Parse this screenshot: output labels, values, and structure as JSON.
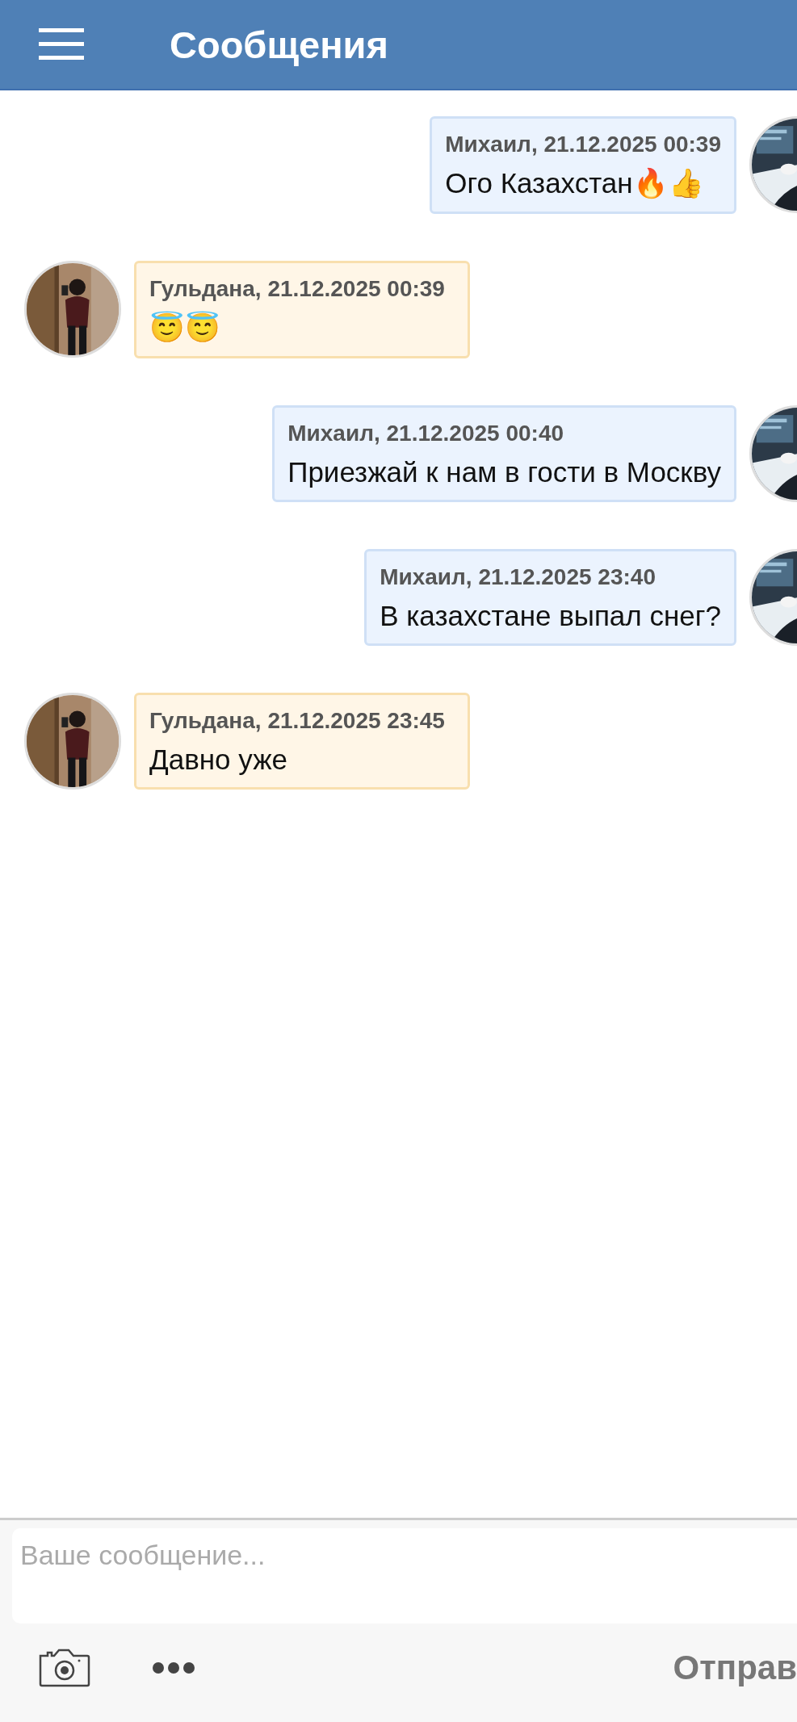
{
  "header": {
    "title": "Сообщения"
  },
  "messages": [
    {
      "kind": "outgoing",
      "meta": "Михаил, 21.12.2025 00:39",
      "text": "Ого Казахстан🔥👍"
    },
    {
      "kind": "incoming",
      "meta": "Гульдана, 21.12.2025 00:39",
      "text": "😇😇"
    },
    {
      "kind": "outgoing",
      "meta": "Михаил, 21.12.2025 00:40",
      "text": "Приезжай к нам в гости в Москву"
    },
    {
      "kind": "outgoing",
      "meta": "Михаил, 21.12.2025 23:40",
      "text": "В казахстане выпал снег?"
    },
    {
      "kind": "incoming",
      "meta": "Гульдана, 21.12.2025 23:45",
      "text": "Давно уже"
    }
  ],
  "composer": {
    "placeholder": "Ваше сообщение...",
    "send_label": "Отправ"
  }
}
